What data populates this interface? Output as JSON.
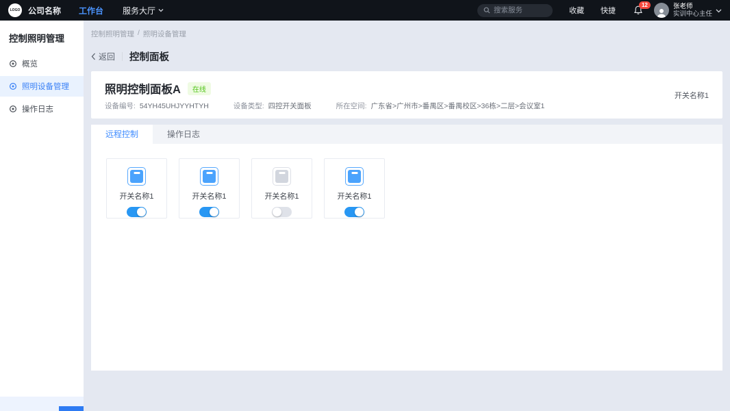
{
  "topbar": {
    "logo_text": "LOGO",
    "company_name": "公司名称",
    "nav": [
      {
        "label": "工作台"
      },
      {
        "label": "服务大厅"
      }
    ],
    "search": {
      "placeholder": "搜索服务"
    },
    "favorites_label": "收藏",
    "shortcuts_label": "快捷",
    "notification_count": "12",
    "user": {
      "name": "张老师",
      "role": "实训中心主任"
    }
  },
  "sidebar": {
    "title": "控制照明管理",
    "items": [
      {
        "label": "概览"
      },
      {
        "label": "照明设备管理"
      },
      {
        "label": "操作日志"
      }
    ]
  },
  "breadcrumb": {
    "items": [
      "控制照明管理",
      "照明设备管理"
    ],
    "separator": "/"
  },
  "page_header": {
    "back_label": "返回",
    "title": "控制面板"
  },
  "device_card": {
    "title": "照明控制面板A",
    "status": "在线",
    "fields": [
      {
        "label": "设备编号:",
        "value": "54YH45UHJYYHTYH"
      },
      {
        "label": "设备类型:",
        "value": "四控开关面板"
      },
      {
        "label": "所在空间:",
        "value": "广东省>广州市>番禺区>番禺校区>36栋>二层>会议室1"
      }
    ],
    "right_label": "开关名称1"
  },
  "tabs": [
    {
      "label": "远程控制"
    },
    {
      "label": "操作日志"
    }
  ],
  "switches": [
    {
      "label": "开关名称1",
      "state": "on"
    },
    {
      "label": "开关名称1",
      "state": "on"
    },
    {
      "label": "开关名称1",
      "state": "off"
    },
    {
      "label": "开关名称1",
      "state": "on"
    }
  ],
  "colors": {
    "topbar_bg": "#10141a",
    "accent_blue": "#3b82f6",
    "topnav_active_blue": "#4b94ff",
    "toggle_on_blue": "#2897f3",
    "icon_blue": "#4aa3fd",
    "status_green": "#52c41a",
    "status_green_bg": "#effbe3",
    "badge_red": "#f5483d",
    "page_bg": "#e4e8f1",
    "sidebar_active_bg": "#e9f2fe"
  }
}
